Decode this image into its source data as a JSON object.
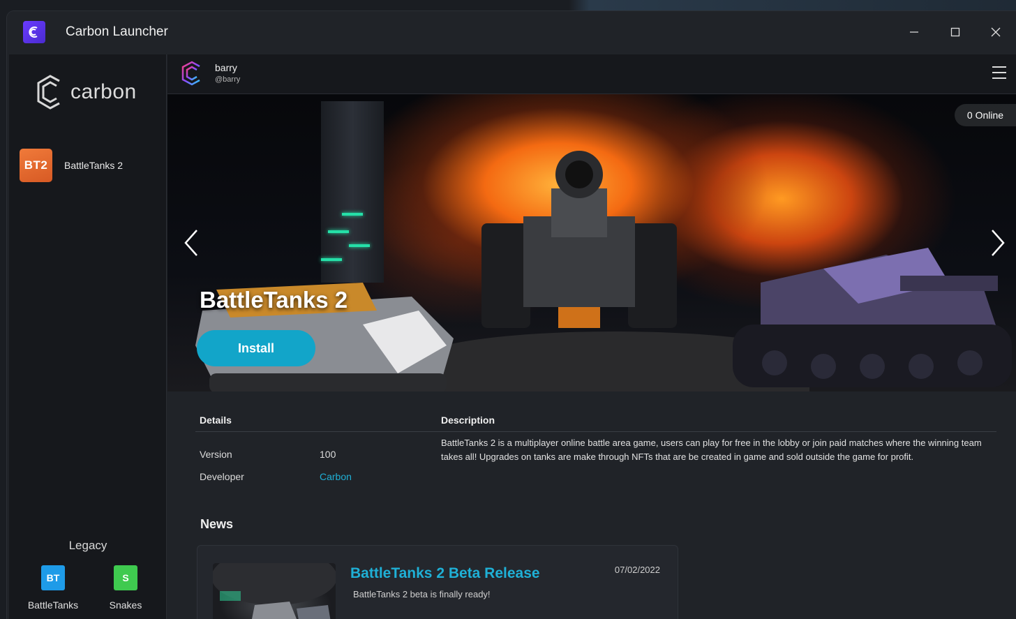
{
  "window": {
    "title": "Carbon Launcher"
  },
  "sidebar": {
    "logo_text": "carbon",
    "games": [
      {
        "tile": "BT2",
        "label": "BattleTanks 2"
      }
    ],
    "legacy": {
      "title": "Legacy",
      "apps": [
        {
          "tile": "BT",
          "label": "BattleTanks",
          "color": "#1e9be8"
        },
        {
          "tile": "S",
          "label": "Snakes",
          "color": "#3fca4f"
        }
      ]
    }
  },
  "user": {
    "name": "barry",
    "handle": "@barry"
  },
  "hero": {
    "online": "0 Online",
    "title": "BattleTanks 2",
    "install_label": "Install"
  },
  "details": {
    "header": "Details",
    "rows": [
      {
        "label": "Version",
        "value": "100"
      },
      {
        "label": "Developer",
        "value": "Carbon"
      }
    ]
  },
  "description": {
    "header": "Description",
    "text": "BattleTanks 2 is a multiplayer online battle area game, users can play for free in the lobby or join paid matches where the winning team takes all! Upgrades on tanks are make through NFTs that are be created in game and sold outside the game for profit."
  },
  "news": {
    "header": "News",
    "items": [
      {
        "headline": "BattleTanks 2 Beta Release",
        "summary": "BattleTanks 2 beta is finally ready!",
        "date": "07/02/2022"
      }
    ]
  },
  "colors": {
    "accent": "#12a5c9",
    "link": "#1fb0d6",
    "brand": "#6a3bff"
  }
}
